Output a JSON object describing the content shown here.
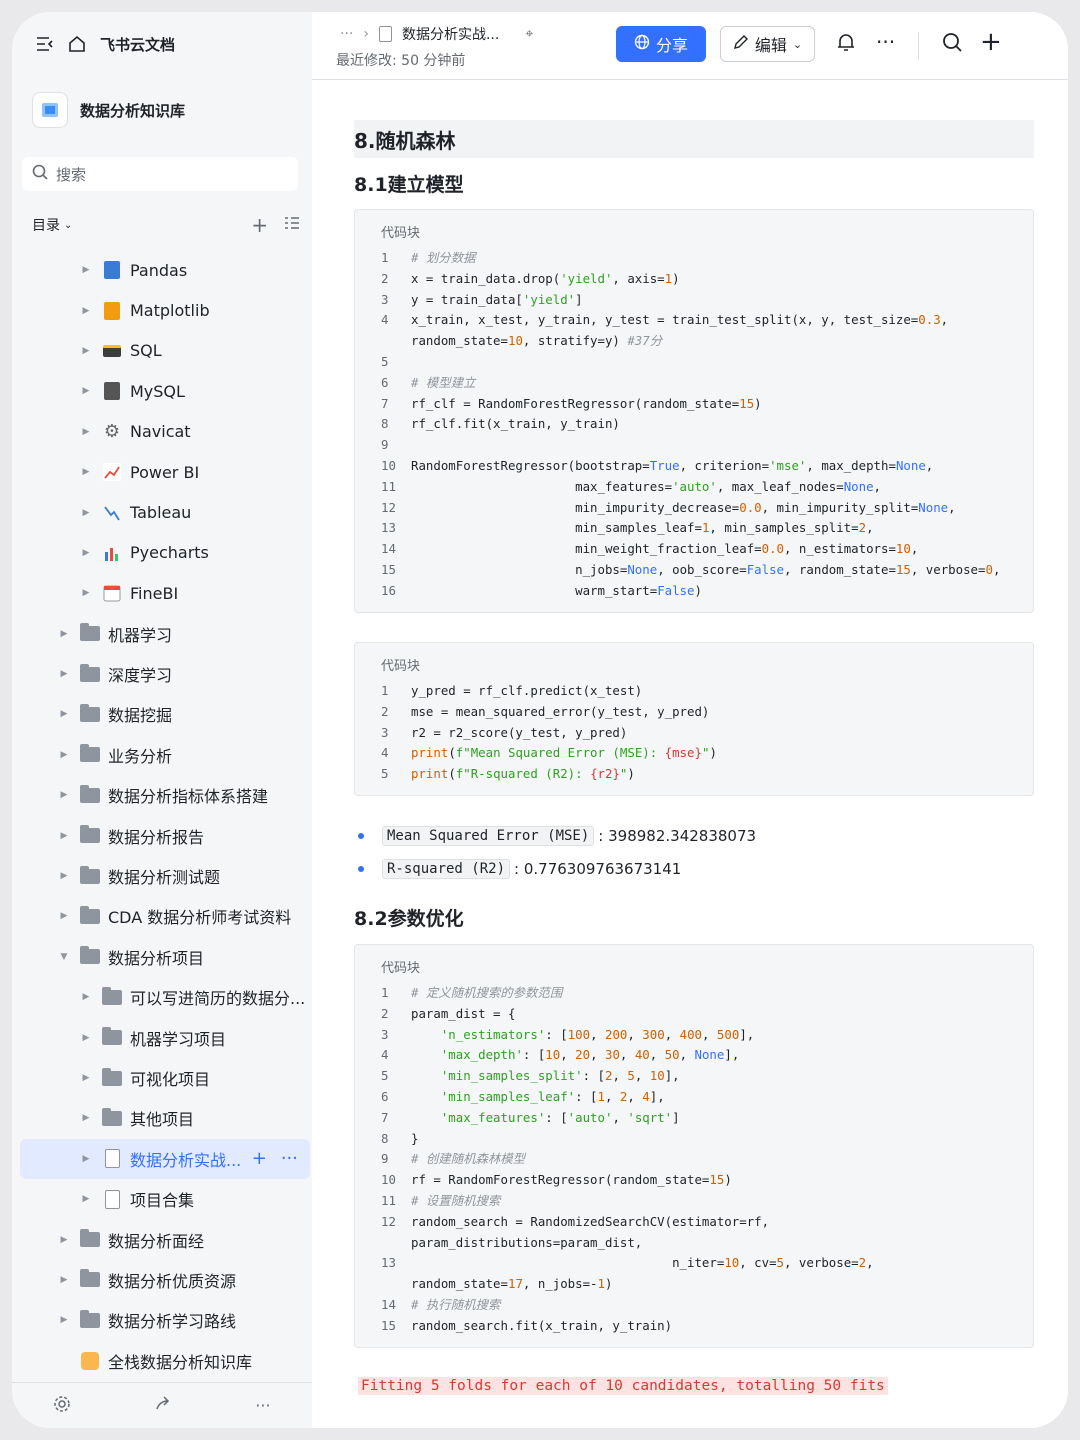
{
  "sidebar": {
    "app_name": "飞书云文档",
    "kb_title": "数据分析知识库",
    "search_placeholder": "搜索",
    "toc_label": "目录",
    "tree": [
      {
        "label": "Pandas",
        "level": 2,
        "icon": "book-icon"
      },
      {
        "label": "Matplotlib",
        "level": 2,
        "icon": "orange-book-icon"
      },
      {
        "label": "SQL",
        "level": 2,
        "icon": "database-icon"
      },
      {
        "label": "MySQL",
        "level": 2,
        "icon": "cabinet-icon"
      },
      {
        "label": "Navicat",
        "level": 2,
        "icon": "gear-icon"
      },
      {
        "label": "Power BI",
        "level": 2,
        "icon": "line-chart-icon"
      },
      {
        "label": "Tableau",
        "level": 2,
        "icon": "trend-icon"
      },
      {
        "label": "Pyecharts",
        "level": 2,
        "icon": "bar-chart-icon"
      },
      {
        "label": "FineBI",
        "level": 2,
        "icon": "calendar-icon"
      },
      {
        "label": "机器学习",
        "level": 1,
        "icon": "folder-icon"
      },
      {
        "label": "深度学习",
        "level": 1,
        "icon": "folder-icon"
      },
      {
        "label": "数据挖掘",
        "level": 1,
        "icon": "folder-icon"
      },
      {
        "label": "业务分析",
        "level": 1,
        "icon": "folder-icon"
      },
      {
        "label": "数据分析指标体系搭建",
        "level": 1,
        "icon": "folder-icon"
      },
      {
        "label": "数据分析报告",
        "level": 1,
        "icon": "folder-icon"
      },
      {
        "label": "数据分析测试题",
        "level": 1,
        "icon": "folder-icon"
      },
      {
        "label": "CDA 数据分析师考试资料",
        "level": 1,
        "icon": "folder-icon"
      },
      {
        "label": "数据分析项目",
        "level": 1,
        "icon": "folder-icon",
        "expanded": true
      },
      {
        "label": "可以写进简历的数据分...",
        "level": 2,
        "icon": "folder-icon"
      },
      {
        "label": "机器学习项目",
        "level": 2,
        "icon": "folder-icon"
      },
      {
        "label": "可视化项目",
        "level": 2,
        "icon": "folder-icon"
      },
      {
        "label": "其他项目",
        "level": 2,
        "icon": "folder-icon"
      },
      {
        "label": "数据分析实战...",
        "level": 2,
        "icon": "doc-icon",
        "active": true
      },
      {
        "label": "项目合集",
        "level": 2,
        "icon": "doc-icon"
      },
      {
        "label": "数据分析面经",
        "level": 1,
        "icon": "folder-icon"
      },
      {
        "label": "数据分析优质资源",
        "level": 1,
        "icon": "folder-icon"
      },
      {
        "label": "数据分析学习路线",
        "level": 1,
        "icon": "folder-icon"
      },
      {
        "label": "全栈数据分析知识库",
        "level": 1,
        "icon": "kb-icon",
        "noarrow": true
      }
    ]
  },
  "topbar": {
    "breadcrumb_more": "···",
    "doc_title": "数据分析实战...",
    "modified": "最近修改: 50 分钟前",
    "share_label": "分享",
    "edit_label": "编辑"
  },
  "doc": {
    "h1": "8.随机森林",
    "h2a": "8.1建立模型",
    "h2b": "8.2参数优化",
    "code_caption": "代码块",
    "code1": [
      [
        "1",
        [
          [
            "cm",
            "# 划分数据"
          ]
        ]
      ],
      [
        "2",
        [
          [
            "t",
            "x = train_data.drop("
          ],
          [
            "st",
            "'yield'"
          ],
          [
            "t",
            ", axis="
          ],
          [
            "nu",
            "1"
          ],
          [
            "t",
            ")"
          ]
        ]
      ],
      [
        "3",
        [
          [
            "t",
            "y = train_data["
          ],
          [
            "st",
            "'yield'"
          ],
          [
            "t",
            "]"
          ]
        ]
      ],
      [
        "4",
        [
          [
            "t",
            "x_train, x_test, y_train, y_test = train_test_split(x, y, test_size="
          ],
          [
            "nu",
            "0.3"
          ],
          [
            "t",
            ","
          ]
        ]
      ],
      [
        "",
        [
          [
            "t",
            "random_state="
          ],
          [
            "nu",
            "10"
          ],
          [
            "t",
            ", stratify=y) "
          ],
          [
            "cm",
            "#37分"
          ]
        ]
      ],
      [
        "5",
        []
      ],
      [
        "6",
        [
          [
            "cm",
            "# 模型建立"
          ]
        ]
      ],
      [
        "7",
        [
          [
            "t",
            "rf_clf = RandomForestRegressor(random_state="
          ],
          [
            "nu",
            "15"
          ],
          [
            "t",
            ")"
          ]
        ]
      ],
      [
        "8",
        [
          [
            "t",
            "rf_clf.fit(x_train, y_train)"
          ]
        ]
      ],
      [
        "9",
        []
      ],
      [
        "10",
        [
          [
            "t",
            "RandomForestRegressor(bootstrap="
          ],
          [
            "kw",
            "True"
          ],
          [
            "t",
            ", criterion="
          ],
          [
            "st",
            "'mse'"
          ],
          [
            "t",
            ", max_depth="
          ],
          [
            "kw",
            "None"
          ],
          [
            "t",
            ","
          ]
        ]
      ],
      [
        "11",
        [
          [
            "t",
            "                      max_features="
          ],
          [
            "st",
            "'auto'"
          ],
          [
            "t",
            ", max_leaf_nodes="
          ],
          [
            "kw",
            "None"
          ],
          [
            "t",
            ","
          ]
        ]
      ],
      [
        "12",
        [
          [
            "t",
            "                      min_impurity_decrease="
          ],
          [
            "nu",
            "0.0"
          ],
          [
            "t",
            ", min_impurity_split="
          ],
          [
            "kw",
            "None"
          ],
          [
            "t",
            ","
          ]
        ]
      ],
      [
        "13",
        [
          [
            "t",
            "                      min_samples_leaf="
          ],
          [
            "nu",
            "1"
          ],
          [
            "t",
            ", min_samples_split="
          ],
          [
            "nu",
            "2"
          ],
          [
            "t",
            ","
          ]
        ]
      ],
      [
        "14",
        [
          [
            "t",
            "                      min_weight_fraction_leaf="
          ],
          [
            "nu",
            "0.0"
          ],
          [
            "t",
            ", n_estimators="
          ],
          [
            "nu",
            "10"
          ],
          [
            "t",
            ","
          ]
        ]
      ],
      [
        "15",
        [
          [
            "t",
            "                      n_jobs="
          ],
          [
            "kw",
            "None"
          ],
          [
            "t",
            ", oob_score="
          ],
          [
            "kw",
            "False"
          ],
          [
            "t",
            ", random_state="
          ],
          [
            "nu",
            "15"
          ],
          [
            "t",
            ", verbose="
          ],
          [
            "nu",
            "0"
          ],
          [
            "t",
            ","
          ]
        ]
      ],
      [
        "16",
        [
          [
            "t",
            "                      warm_start="
          ],
          [
            "kw",
            "False"
          ],
          [
            "t",
            ")"
          ]
        ]
      ]
    ],
    "code2": [
      [
        "1",
        [
          [
            "t",
            "y_pred = rf_clf.predict(x_test)"
          ]
        ]
      ],
      [
        "2",
        [
          [
            "t",
            "mse = mean_squared_error(y_test, y_pred)"
          ]
        ]
      ],
      [
        "3",
        [
          [
            "t",
            "r2 = r2_score(y_test, y_pred)"
          ]
        ]
      ],
      [
        "4",
        [
          [
            "nu",
            "print"
          ],
          [
            "t",
            "("
          ],
          [
            "st",
            "f\"Mean Squared Error (MSE): "
          ],
          [
            "fn",
            "{mse}"
          ],
          [
            "st",
            "\""
          ],
          [
            "t",
            ")"
          ]
        ]
      ],
      [
        "5",
        [
          [
            "nu",
            "print"
          ],
          [
            "t",
            "("
          ],
          [
            "st",
            "f\"R-squared (R2): "
          ],
          [
            "fn",
            "{r2}"
          ],
          [
            "st",
            "\""
          ],
          [
            "t",
            ")"
          ]
        ]
      ]
    ],
    "bullets": [
      {
        "code": "Mean Squared Error (MSE)",
        "value": ": 398982.342838073"
      },
      {
        "code": "R-squared (R2)",
        "value": ": 0.776309763673141"
      }
    ],
    "code3": [
      [
        "1",
        [
          [
            "cm",
            "# 定义随机搜索的参数范围"
          ]
        ]
      ],
      [
        "2",
        [
          [
            "t",
            "param_dist = {"
          ]
        ]
      ],
      [
        "3",
        [
          [
            "t",
            "    "
          ],
          [
            "st",
            "'n_estimators'"
          ],
          [
            "t",
            ": ["
          ],
          [
            "nu",
            "100"
          ],
          [
            "t",
            ", "
          ],
          [
            "nu",
            "200"
          ],
          [
            "t",
            ", "
          ],
          [
            "nu",
            "300"
          ],
          [
            "t",
            ", "
          ],
          [
            "nu",
            "400"
          ],
          [
            "t",
            ", "
          ],
          [
            "nu",
            "500"
          ],
          [
            "t",
            "],"
          ]
        ]
      ],
      [
        "4",
        [
          [
            "t",
            "    "
          ],
          [
            "st",
            "'max_depth'"
          ],
          [
            "t",
            ": ["
          ],
          [
            "nu",
            "10"
          ],
          [
            "t",
            ", "
          ],
          [
            "nu",
            "20"
          ],
          [
            "t",
            ", "
          ],
          [
            "nu",
            "30"
          ],
          [
            "t",
            ", "
          ],
          [
            "nu",
            "40"
          ],
          [
            "t",
            ", "
          ],
          [
            "nu",
            "50"
          ],
          [
            "t",
            ", "
          ],
          [
            "kw",
            "None"
          ],
          [
            "t",
            "],"
          ]
        ]
      ],
      [
        "5",
        [
          [
            "t",
            "    "
          ],
          [
            "st",
            "'min_samples_split'"
          ],
          [
            "t",
            ": ["
          ],
          [
            "nu",
            "2"
          ],
          [
            "t",
            ", "
          ],
          [
            "nu",
            "5"
          ],
          [
            "t",
            ", "
          ],
          [
            "nu",
            "10"
          ],
          [
            "t",
            "],"
          ]
        ]
      ],
      [
        "6",
        [
          [
            "t",
            "    "
          ],
          [
            "st",
            "'min_samples_leaf'"
          ],
          [
            "t",
            ": ["
          ],
          [
            "nu",
            "1"
          ],
          [
            "t",
            ", "
          ],
          [
            "nu",
            "2"
          ],
          [
            "t",
            ", "
          ],
          [
            "nu",
            "4"
          ],
          [
            "t",
            "],"
          ]
        ]
      ],
      [
        "7",
        [
          [
            "t",
            "    "
          ],
          [
            "st",
            "'max_features'"
          ],
          [
            "t",
            ": ["
          ],
          [
            "st",
            "'auto'"
          ],
          [
            "t",
            ", "
          ],
          [
            "st",
            "'sqrt'"
          ],
          [
            "t",
            "]"
          ]
        ]
      ],
      [
        "8",
        [
          [
            "t",
            "}"
          ]
        ]
      ],
      [
        "9",
        [
          [
            "cm",
            "# 创建随机森林模型"
          ]
        ]
      ],
      [
        "10",
        [
          [
            "t",
            "rf = RandomForestRegressor(random_state="
          ],
          [
            "nu",
            "15"
          ],
          [
            "t",
            ")"
          ]
        ]
      ],
      [
        "11",
        [
          [
            "cm",
            "# 设置随机搜索"
          ]
        ]
      ],
      [
        "12",
        [
          [
            "t",
            "random_search = RandomizedSearchCV(estimator=rf,"
          ]
        ]
      ],
      [
        "",
        [
          [
            "t",
            "param_distributions=param_dist,"
          ]
        ]
      ],
      [
        "13",
        [
          [
            "t",
            "                                   n_iter="
          ],
          [
            "nu",
            "10"
          ],
          [
            "t",
            ", cv="
          ],
          [
            "nu",
            "5"
          ],
          [
            "t",
            ", verbose="
          ],
          [
            "nu",
            "2"
          ],
          [
            "t",
            ","
          ]
        ]
      ],
      [
        "",
        [
          [
            "t",
            "random_state="
          ],
          [
            "nu",
            "17"
          ],
          [
            "t",
            ", n_jobs=-"
          ],
          [
            "nu",
            "1"
          ],
          [
            "t",
            ")"
          ]
        ]
      ],
      [
        "14",
        [
          [
            "cm",
            "# 执行随机搜索"
          ]
        ]
      ],
      [
        "15",
        [
          [
            "t",
            "random_search.fit(x_train, y_train)"
          ]
        ]
      ]
    ],
    "output_line": "Fitting 5 folds for each of 10 candidates, totalling 50 fits"
  }
}
